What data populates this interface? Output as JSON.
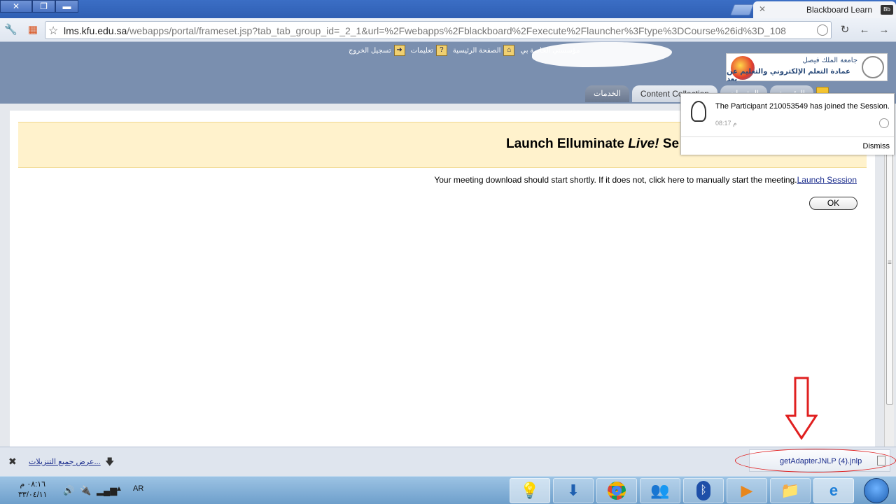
{
  "browser": {
    "tab_title": "Blackboard Learn",
    "tab_favicon": "Bb",
    "url_host": "lms.kfu.edu.sa",
    "url_path": "/webapps/portal/frameset.jsp?tab_tab_group_id=_2_1&url=%2Fwebapps%2Fblackboard%2Fexecute%2Flauncher%3Ftype%3DCourse%26id%3D_108"
  },
  "site": {
    "top_links": [
      "مؤسستي الخاصة بي",
      "الصفحة الرئيسية",
      "تعليمات",
      "تسجيل الخروج"
    ],
    "logo_line1": "جامعة الملك فيصل",
    "logo_line2": "عمادة التعلم الإلكتروني والتعليم عن بعد",
    "nav_tabs": [
      "الخدمات",
      "Content Collection",
      "المقررات",
      "الرئيسية"
    ]
  },
  "page": {
    "banner_title_pre": "Launch Elluminate ",
    "banner_title_italic": "Live!",
    "banner_title_post": " Se",
    "message": "Your meeting download should start shortly. If it does not, click here to manually start the meeting.",
    "launch_link": "Launch Session",
    "ok_label": "OK"
  },
  "notification": {
    "text": "The Participant 210053549 has joined the Session.",
    "time": "08:17 م",
    "dismiss": "Dismiss"
  },
  "downloads": {
    "show_all": "عرض جميع التنزيلات...",
    "file_name": "getAdapterJNLP (4).jnlp"
  },
  "taskbar": {
    "time": "٠٨:١٦ م",
    "date": "٣٣/٠٤/١١",
    "language": "AR"
  },
  "colors": {
    "header_bg": "#7a8faf",
    "banner_bg": "#fff2cc",
    "link": "#1a2c8c",
    "annotation": "#e02020"
  }
}
